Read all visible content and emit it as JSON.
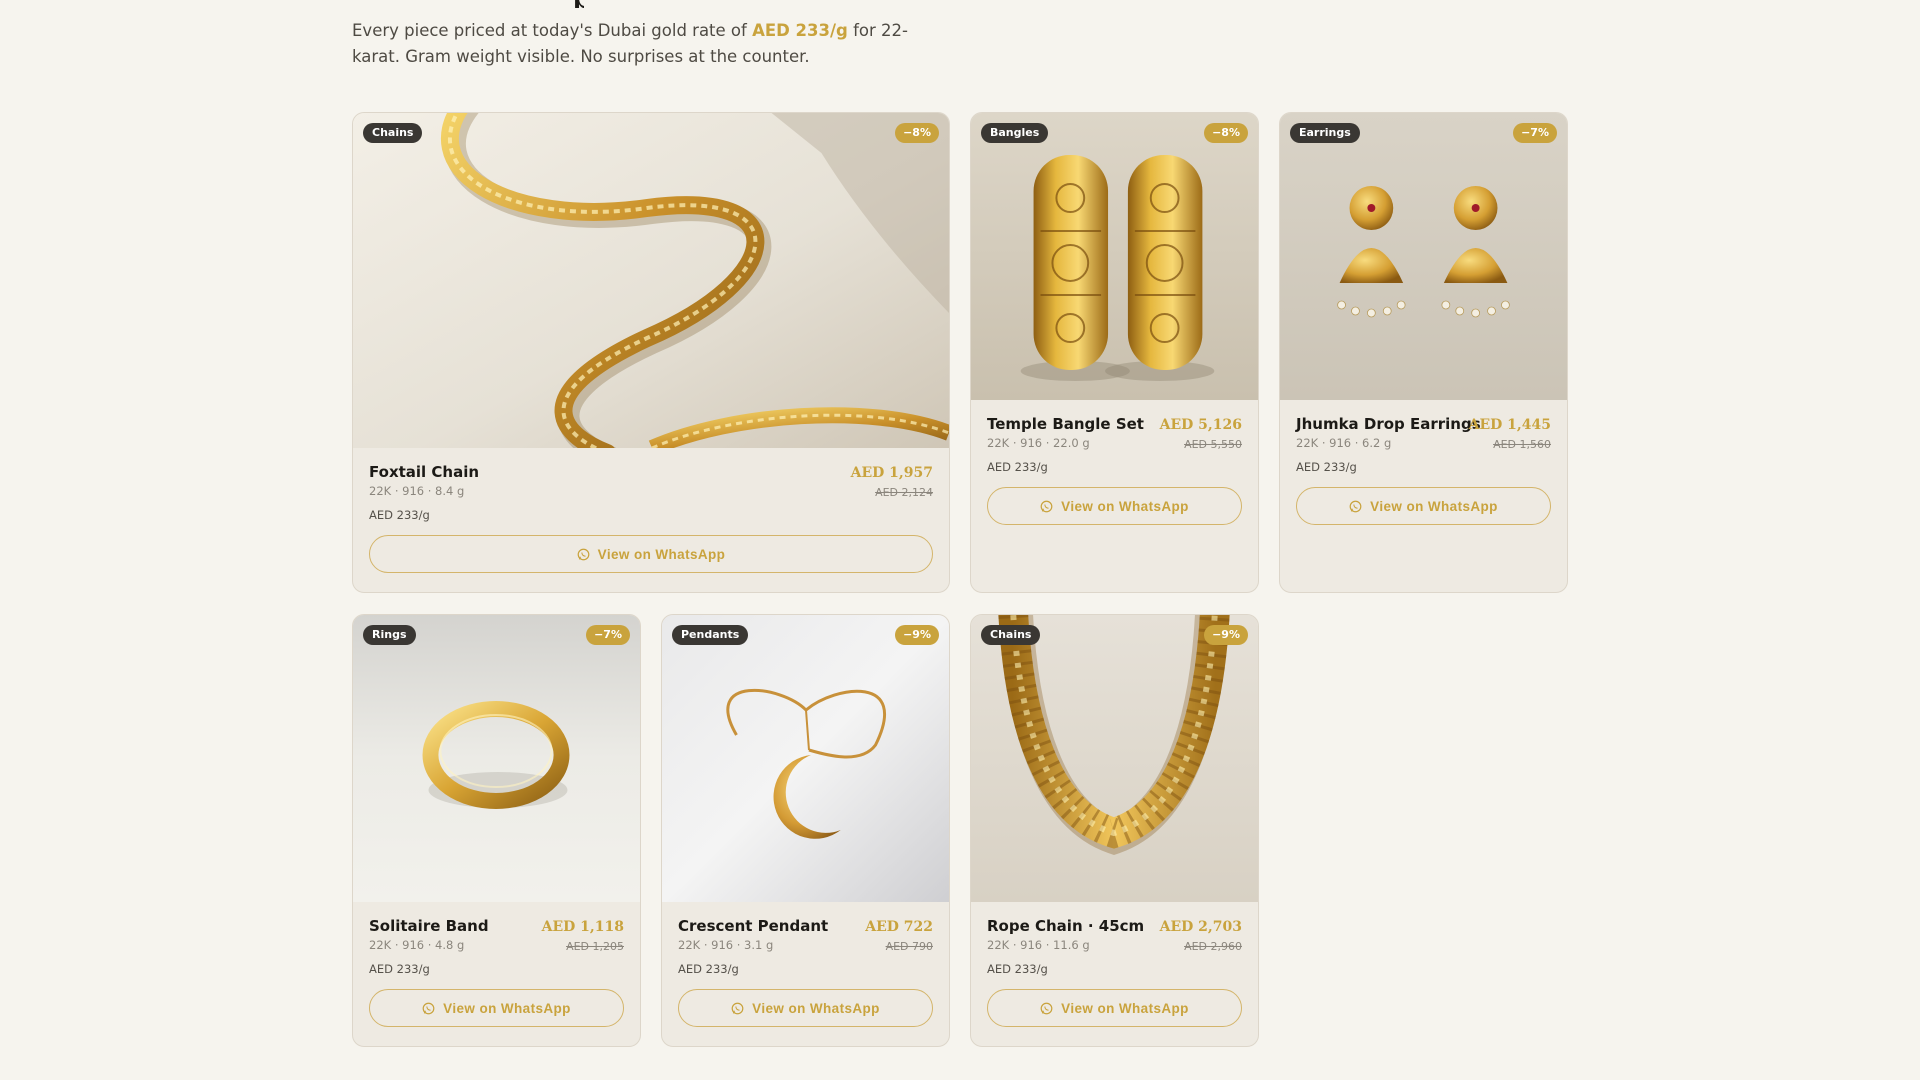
{
  "header": {
    "heading_fragment": "p",
    "intro_prefix": "Every piece priced at today's Dubai gold rate of ",
    "intro_rate": "AED 233/g",
    "intro_suffix": " for 22-karat. Gram weight visible. No surprises at the counter."
  },
  "products": [
    {
      "category": "Chains",
      "discount": "−8%",
      "name": "Foxtail Chain",
      "spec": "22K · 916 · 8.4 g",
      "price": "AED 1,957",
      "old_price": "AED 2,124",
      "rate": "AED 233/g",
      "button": "View on WhatsApp",
      "icon": "foxtail-chain-photo"
    },
    {
      "category": "Bangles",
      "discount": "−8%",
      "name": "Temple Bangle Set",
      "spec": "22K · 916 · 22.0 g",
      "price": "AED 5,126",
      "old_price": "AED 5,550",
      "rate": "AED 233/g",
      "button": "View on WhatsApp",
      "icon": "bangle-photo"
    },
    {
      "category": "Earrings",
      "discount": "−7%",
      "name": "Jhumka Drop Earrings",
      "spec": "22K · 916 · 6.2 g",
      "price": "AED 1,445",
      "old_price": "AED 1,560",
      "rate": "AED 233/g",
      "button": "View on WhatsApp",
      "icon": "earrings-photo"
    },
    {
      "category": "Rings",
      "discount": "−7%",
      "name": "Solitaire Band",
      "spec": "22K · 916 · 4.8 g",
      "price": "AED 1,118",
      "old_price": "AED 1,205",
      "rate": "AED 233/g",
      "button": "View on WhatsApp",
      "icon": "ring-photo"
    },
    {
      "category": "Pendants",
      "discount": "−9%",
      "name": "Crescent Pendant",
      "spec": "22K · 916 · 3.1 g",
      "price": "AED 722",
      "old_price": "AED 790",
      "rate": "AED 233/g",
      "button": "View on WhatsApp",
      "icon": "pendant-photo"
    },
    {
      "category": "Chains",
      "discount": "−9%",
      "name": "Rope Chain · 45cm",
      "spec": "22K · 916 · 11.6 g",
      "price": "AED 2,703",
      "old_price": "AED 2,960",
      "rate": "AED 233/g",
      "button": "View on WhatsApp",
      "icon": "rope-chain-photo"
    }
  ],
  "colors": {
    "accent": "#c9a33d",
    "background": "#f6f4ee",
    "card": "#eeeae2",
    "tag": "#3a3733"
  }
}
